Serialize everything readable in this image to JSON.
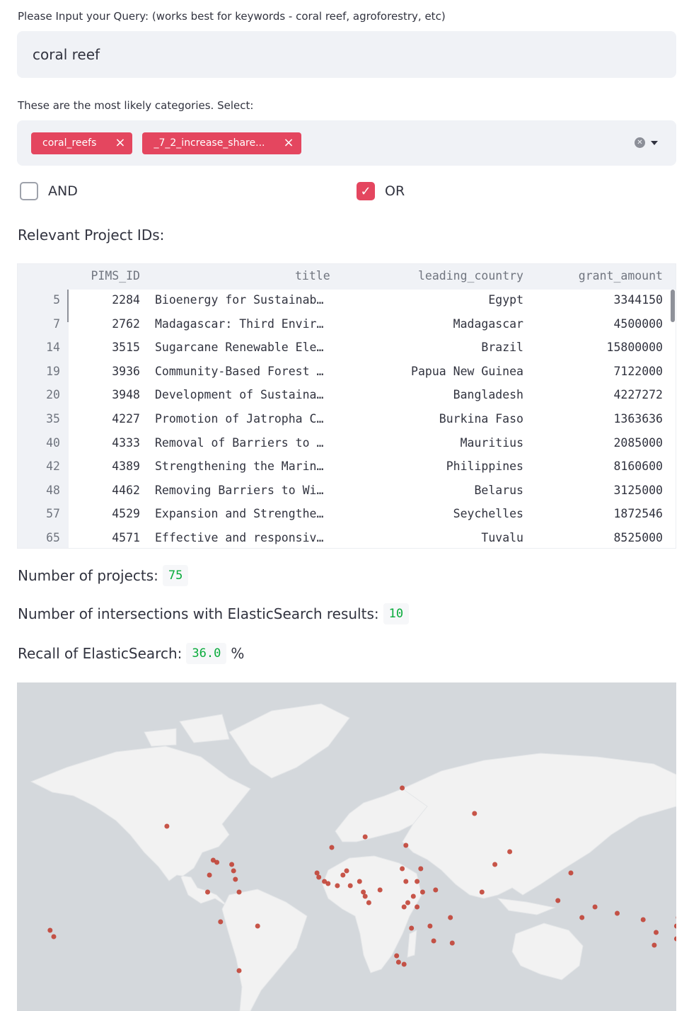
{
  "query": {
    "label": "Please Input your Query: (works best for keywords - coral reef, agroforestry, etc)",
    "value": "coral reef"
  },
  "categories": {
    "label": "These are the most likely categories. Select:",
    "tags": [
      {
        "label": "coral_reefs"
      },
      {
        "label": "_7_2_increase_share..."
      }
    ],
    "remove_icon": "close-icon",
    "clear_icon": "clear-all-icon",
    "dropdown_icon": "chevron-down-icon"
  },
  "logic": {
    "and_label": "AND",
    "and_checked": false,
    "or_label": "OR",
    "or_checked": true
  },
  "table": {
    "title": "Relevant Project IDs:",
    "columns": [
      "",
      "PIMS_ID",
      "title",
      "leading_country",
      "grant_amount"
    ],
    "rows": [
      {
        "index": "5",
        "pims_id": "2284",
        "title": "Bioenergy for Sustainab…",
        "country": "Egypt",
        "amount": "3344150"
      },
      {
        "index": "7",
        "pims_id": "2762",
        "title": "Madagascar: Third Envir…",
        "country": "Madagascar",
        "amount": "4500000"
      },
      {
        "index": "14",
        "pims_id": "3515",
        "title": "Sugarcane Renewable Ele…",
        "country": "Brazil",
        "amount": "15800000"
      },
      {
        "index": "19",
        "pims_id": "3936",
        "title": "Community-Based Forest …",
        "country": "Papua New Guinea",
        "amount": "7122000"
      },
      {
        "index": "20",
        "pims_id": "3948",
        "title": "Development of Sustaina…",
        "country": "Bangladesh",
        "amount": "4227272"
      },
      {
        "index": "35",
        "pims_id": "4227",
        "title": "Promotion of Jatropha C…",
        "country": "Burkina Faso",
        "amount": "1363636"
      },
      {
        "index": "40",
        "pims_id": "4333",
        "title": "Removal of Barriers to …",
        "country": "Mauritius",
        "amount": "2085000"
      },
      {
        "index": "42",
        "pims_id": "4389",
        "title": "Strengthening the Marin…",
        "country": "Philippines",
        "amount": "8160600"
      },
      {
        "index": "48",
        "pims_id": "4462",
        "title": "Removing Barriers to Wi…",
        "country": "Belarus",
        "amount": "3125000"
      },
      {
        "index": "57",
        "pims_id": "4529",
        "title": "Expansion and Strengthe…",
        "country": "Seychelles",
        "amount": "1872546"
      },
      {
        "index": "65",
        "pims_id": "4571",
        "title": "Effective and responsiv…",
        "country": "Tuvalu",
        "amount": "8525000"
      }
    ]
  },
  "metrics": {
    "projects_label": "Number of projects:",
    "projects_value": "75",
    "intersections_label": "Number of intersections with ElasticSearch results:",
    "intersections_value": "10",
    "recall_label": "Recall of ElasticSearch:",
    "recall_value": "36.0",
    "recall_unit": "%"
  },
  "map": {
    "ocean_color": "#d4d8dc",
    "land_color": "#f2f2f2",
    "point_color": "#c0392b",
    "points": [
      {
        "lon": -97,
        "lat": 35
      },
      {
        "lon": -72,
        "lat": 19
      },
      {
        "lon": -70,
        "lat": 18
      },
      {
        "lon": -62,
        "lat": 17
      },
      {
        "lon": -61,
        "lat": 14
      },
      {
        "lon": -74,
        "lat": 12
      },
      {
        "lon": -60,
        "lat": 10
      },
      {
        "lon": -75,
        "lat": 4
      },
      {
        "lon": -58,
        "lat": 4
      },
      {
        "lon": -68,
        "lat": -10
      },
      {
        "lon": -48,
        "lat": -12
      },
      {
        "lon": -58,
        "lat": -33
      },
      {
        "lon": -160,
        "lat": -14
      },
      {
        "lon": -158,
        "lat": -17
      },
      {
        "lon": 30,
        "lat": 53
      },
      {
        "lon": 69,
        "lat": 41
      },
      {
        "lon": 32,
        "lat": 26
      },
      {
        "lon": 10,
        "lat": 30
      },
      {
        "lon": -8,
        "lat": 25
      },
      {
        "lon": 0,
        "lat": 14
      },
      {
        "lon": -2,
        "lat": 12
      },
      {
        "lon": -16,
        "lat": 13
      },
      {
        "lon": -15,
        "lat": 11
      },
      {
        "lon": -10,
        "lat": 8
      },
      {
        "lon": -12,
        "lat": 9
      },
      {
        "lon": -5,
        "lat": 7
      },
      {
        "lon": 2,
        "lat": 7
      },
      {
        "lon": 7,
        "lat": 9
      },
      {
        "lon": 9,
        "lat": 4
      },
      {
        "lon": 10,
        "lat": 2
      },
      {
        "lon": 12,
        "lat": -1
      },
      {
        "lon": 18,
        "lat": 5
      },
      {
        "lon": 30,
        "lat": 15
      },
      {
        "lon": 40,
        "lat": 15
      },
      {
        "lon": 38,
        "lat": 9
      },
      {
        "lon": 32,
        "lat": 9
      },
      {
        "lon": 36,
        "lat": 2
      },
      {
        "lon": 41,
        "lat": 4
      },
      {
        "lon": 38,
        "lat": -3
      },
      {
        "lon": 33,
        "lat": -1
      },
      {
        "lon": 31,
        "lat": -3
      },
      {
        "lon": 35,
        "lat": -13
      },
      {
        "lon": 47,
        "lat": -19
      },
      {
        "lon": 45,
        "lat": -12
      },
      {
        "lon": 56,
        "lat": -8
      },
      {
        "lon": 57,
        "lat": -20
      },
      {
        "lon": 27,
        "lat": -26
      },
      {
        "lon": 28,
        "lat": -29
      },
      {
        "lon": 31,
        "lat": -30
      },
      {
        "lon": 48,
        "lat": 5
      },
      {
        "lon": 73,
        "lat": 4
      },
      {
        "lon": 80,
        "lat": 17
      },
      {
        "lon": 88,
        "lat": 23
      },
      {
        "lon": 121,
        "lat": 13
      },
      {
        "lon": 114,
        "lat": 0
      },
      {
        "lon": 146,
        "lat": -6
      },
      {
        "lon": 160,
        "lat": -9
      },
      {
        "lon": 167,
        "lat": -15
      },
      {
        "lon": 179,
        "lat": -8
      },
      {
        "lon": 178,
        "lat": -18
      },
      {
        "lon": 166,
        "lat": -21
      },
      {
        "lon": 134,
        "lat": -3
      },
      {
        "lon": 178,
        "lat": -12
      },
      {
        "lon": 127,
        "lat": -8
      }
    ]
  }
}
